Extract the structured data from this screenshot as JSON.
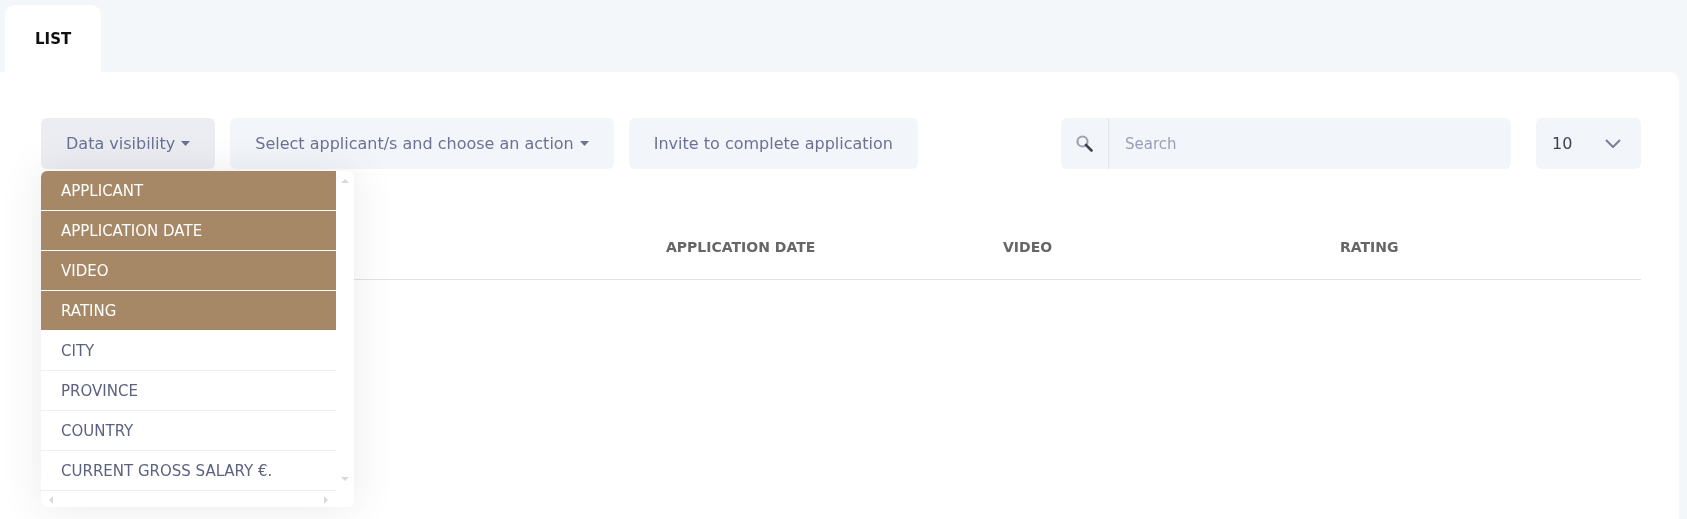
{
  "tabs": [
    {
      "label": "LIST",
      "selected": true
    }
  ],
  "toolbar": {
    "data_visibility": "Data visibility",
    "bulk_action": "Select applicant/s and choose an action",
    "invite": "Invite to complete application",
    "search": {
      "placeholder": "Search"
    },
    "page_size": "10"
  },
  "visibility_menu": [
    {
      "label": "APPLICANT",
      "selected": true
    },
    {
      "label": "APPLICATION DATE",
      "selected": true
    },
    {
      "label": "VIDEO",
      "selected": true
    },
    {
      "label": "RATING",
      "selected": true
    },
    {
      "label": "CITY",
      "selected": false
    },
    {
      "label": "PROVINCE",
      "selected": false
    },
    {
      "label": "COUNTRY",
      "selected": false
    },
    {
      "label": "CURRENT GROSS SALARY €.",
      "selected": false
    }
  ],
  "table": {
    "columns": [
      "APPLICATION DATE",
      "VIDEO",
      "RATING"
    ]
  }
}
